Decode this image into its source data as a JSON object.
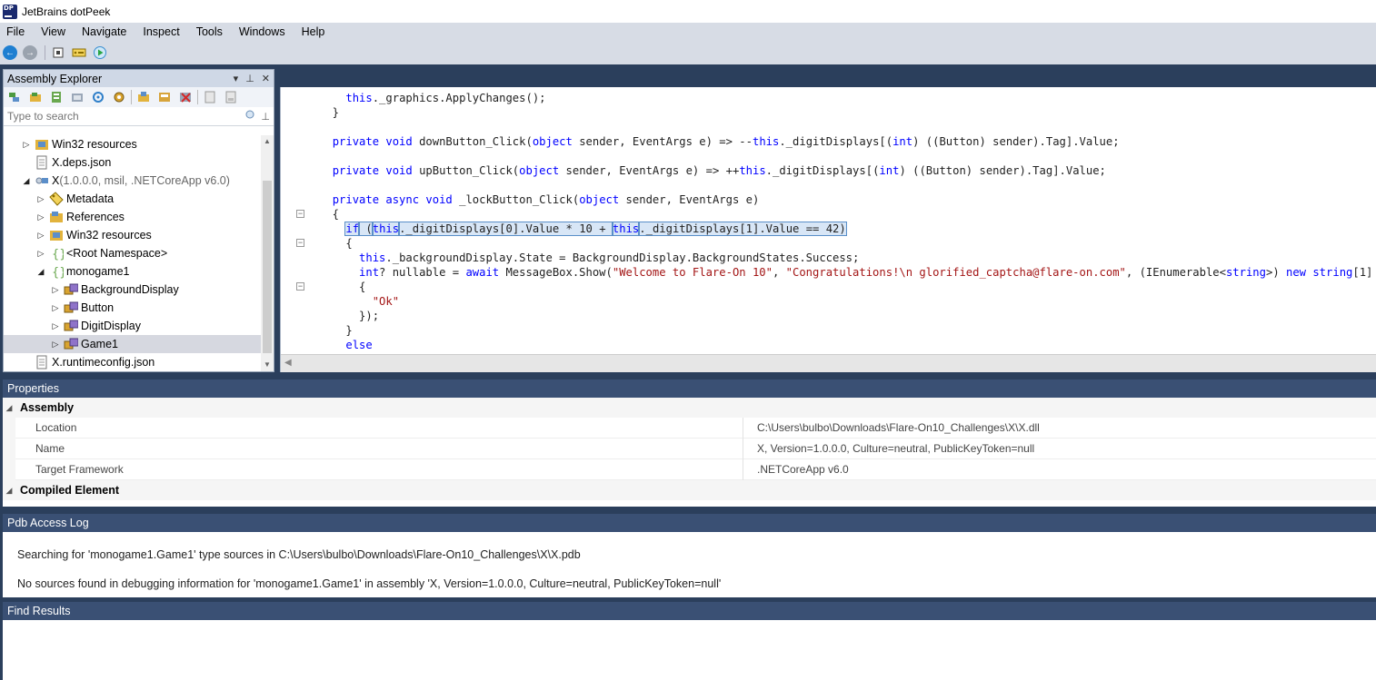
{
  "window": {
    "title": "JetBrains dotPeek"
  },
  "menu": [
    "File",
    "View",
    "Navigate",
    "Inspect",
    "Tools",
    "Windows",
    "Help"
  ],
  "assembly_explorer": {
    "title": "Assembly Explorer",
    "search_placeholder": "Type to search",
    "tree": [
      {
        "label": "Win32 resources",
        "detail": "",
        "icon": "resources-icon",
        "expand": "collapsed",
        "indent": 0
      },
      {
        "label": "X.deps.json",
        "detail": "",
        "icon": "file-icon",
        "expand": "none",
        "indent": 0
      },
      {
        "label": "X",
        "detail": "(1.0.0.0, msil, .NETCoreApp v6.0)",
        "icon": "assembly-icon",
        "expand": "expanded",
        "indent": 0
      },
      {
        "label": "Metadata",
        "detail": "",
        "icon": "metadata-icon",
        "expand": "collapsed",
        "indent": 1
      },
      {
        "label": "References",
        "detail": "",
        "icon": "references-icon",
        "expand": "collapsed",
        "indent": 1
      },
      {
        "label": "Win32 resources",
        "detail": "",
        "icon": "resources-icon",
        "expand": "collapsed",
        "indent": 1
      },
      {
        "label": "<Root Namespace>",
        "detail": "",
        "icon": "namespace-icon",
        "expand": "collapsed",
        "indent": 1
      },
      {
        "label": "monogame1",
        "detail": "",
        "icon": "namespace-icon",
        "expand": "expanded",
        "indent": 1
      },
      {
        "label": "BackgroundDisplay",
        "detail": "",
        "icon": "class-icon",
        "expand": "collapsed",
        "indent": 2
      },
      {
        "label": "Button",
        "detail": "",
        "icon": "class-icon",
        "expand": "collapsed",
        "indent": 2
      },
      {
        "label": "DigitDisplay",
        "detail": "",
        "icon": "class-icon",
        "expand": "collapsed",
        "indent": 2
      },
      {
        "label": "Game1",
        "detail": "",
        "icon": "class-icon",
        "expand": "collapsed",
        "indent": 2,
        "selected": true
      },
      {
        "label": "X.runtimeconfig.json",
        "detail": "",
        "icon": "file-icon",
        "expand": "none",
        "indent": 0
      }
    ]
  },
  "code": {
    "lines": [
      [
        {
          "t": "    "
        },
        {
          "t": "this",
          "c": "kw"
        },
        {
          "t": "._graphics.ApplyChanges();"
        }
      ],
      [
        {
          "t": "  }"
        }
      ],
      [
        {
          "t": ""
        }
      ],
      [
        {
          "t": "  "
        },
        {
          "t": "private void",
          "c": "kw"
        },
        {
          "t": " downButton_Click("
        },
        {
          "t": "object",
          "c": "kw"
        },
        {
          "t": " sender, EventArgs e) => --"
        },
        {
          "t": "this",
          "c": "kw"
        },
        {
          "t": "._digitDisplays[("
        },
        {
          "t": "int",
          "c": "kw"
        },
        {
          "t": ") ((Button) sender).Tag].Value;"
        }
      ],
      [
        {
          "t": ""
        }
      ],
      [
        {
          "t": "  "
        },
        {
          "t": "private void",
          "c": "kw"
        },
        {
          "t": " upButton_Click("
        },
        {
          "t": "object",
          "c": "kw"
        },
        {
          "t": " sender, EventArgs e) => ++"
        },
        {
          "t": "this",
          "c": "kw"
        },
        {
          "t": "._digitDisplays[("
        },
        {
          "t": "int",
          "c": "kw"
        },
        {
          "t": ") ((Button) sender).Tag].Value;"
        }
      ],
      [
        {
          "t": ""
        }
      ],
      [
        {
          "t": "  "
        },
        {
          "t": "private async void",
          "c": "kw"
        },
        {
          "t": " _lockButton_Click("
        },
        {
          "t": "object",
          "c": "kw"
        },
        {
          "t": " sender, EventArgs e)"
        }
      ],
      [
        {
          "t": "  {"
        }
      ],
      [
        {
          "t": "    "
        },
        {
          "t": "if",
          "c": "kw hl"
        },
        {
          "t": " (",
          "c": "hl"
        },
        {
          "t": "this",
          "c": "kw hl"
        },
        {
          "t": "._digitDisplays[0].Value * 10 + ",
          "c": "hl"
        },
        {
          "t": "this",
          "c": "kw hl"
        },
        {
          "t": "._digitDisplays[1].Value == 42)",
          "c": "hl"
        }
      ],
      [
        {
          "t": "    {"
        }
      ],
      [
        {
          "t": "      "
        },
        {
          "t": "this",
          "c": "kw"
        },
        {
          "t": "._backgroundDisplay.State = BackgroundDisplay.BackgroundStates.Success;"
        }
      ],
      [
        {
          "t": "      "
        },
        {
          "t": "int",
          "c": "kw"
        },
        {
          "t": "? nullable = "
        },
        {
          "t": "await",
          "c": "kw"
        },
        {
          "t": " MessageBox.Show("
        },
        {
          "t": "\"Welcome to Flare-On 10\"",
          "c": "str"
        },
        {
          "t": ", "
        },
        {
          "t": "\"Congratulations!\\n glorified_captcha@flare-on.com\"",
          "c": "str"
        },
        {
          "t": ", (IEnumerable<"
        },
        {
          "t": "string",
          "c": "kw"
        },
        {
          "t": ">) "
        },
        {
          "t": "new string",
          "c": "kw"
        },
        {
          "t": "[1]"
        }
      ],
      [
        {
          "t": "      {"
        }
      ],
      [
        {
          "t": "        "
        },
        {
          "t": "\"Ok\"",
          "c": "str"
        }
      ],
      [
        {
          "t": "      });"
        }
      ],
      [
        {
          "t": "    }"
        }
      ],
      [
        {
          "t": "    "
        },
        {
          "t": "else",
          "c": "kw"
        }
      ]
    ]
  },
  "properties": {
    "title": "Properties",
    "groups": [
      {
        "name": "Assembly",
        "rows": [
          {
            "name": "Location",
            "value": "C:\\Users\\bulbo\\Downloads\\Flare-On10_Challenges\\X\\X.dll"
          },
          {
            "name": "Name",
            "value": "X, Version=1.0.0.0, Culture=neutral, PublicKeyToken=null"
          },
          {
            "name": "Target Framework",
            "value": ".NETCoreApp v6.0"
          }
        ]
      },
      {
        "name": "Compiled Element",
        "rows": []
      }
    ]
  },
  "pdb_log": {
    "title": "Pdb Access Log",
    "lines": [
      "Searching for 'monogame1.Game1' type sources in C:\\Users\\bulbo\\Downloads\\Flare-On10_Challenges\\X\\X.pdb",
      "No sources found in debugging information for 'monogame1.Game1' in assembly 'X, Version=1.0.0.0, Culture=neutral, PublicKeyToken=null'"
    ]
  },
  "find_results": {
    "title": "Find Results"
  }
}
